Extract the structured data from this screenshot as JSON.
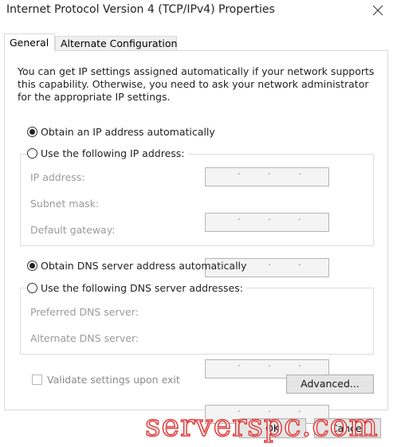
{
  "window": {
    "title": "Internet Protocol Version 4 (TCP/IPv4) Properties"
  },
  "tabs": [
    {
      "label": "General",
      "active": true
    },
    {
      "label": "Alternate Configuration",
      "active": false
    }
  ],
  "description": "You can get IP settings assigned automatically if your network supports this capability. Otherwise, you need to ask your network administrator for the appropriate IP settings.",
  "ip": {
    "auto_label": "Obtain an IP address automatically",
    "auto_selected": true,
    "manual_label": "Use the following IP address:",
    "fields": [
      {
        "label": "IP address:",
        "value": ""
      },
      {
        "label": "Subnet mask:",
        "value": ""
      },
      {
        "label": "Default gateway:",
        "value": ""
      }
    ]
  },
  "dns": {
    "auto_label": "Obtain DNS server address automatically",
    "auto_selected": true,
    "manual_label": "Use the following DNS server addresses:",
    "fields": [
      {
        "label": "Preferred DNS server:",
        "value": ""
      },
      {
        "label": "Alternate DNS server:",
        "value": ""
      }
    ]
  },
  "validate_label": "Validate settings upon exit",
  "buttons": {
    "advanced": "Advanced...",
    "ok": "OK",
    "cancel": "Cancel"
  },
  "watermark": "serverspc.com",
  "icons": {
    "close": "close-icon"
  }
}
